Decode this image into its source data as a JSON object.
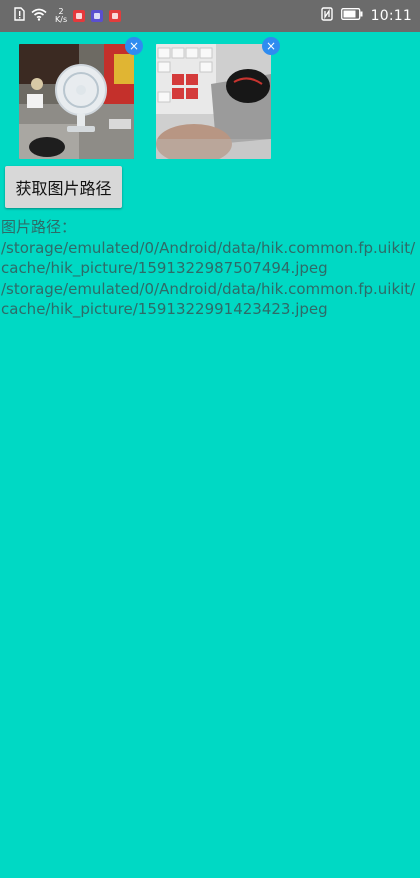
{
  "status_bar": {
    "speed_value": "2",
    "speed_unit": "K/s",
    "time": "10:11",
    "icons": [
      "sim-icon",
      "wifi-icon",
      "app-badge-red",
      "app-badge-blue",
      "app-badge-red2",
      "nfc-icon",
      "battery-icon"
    ],
    "badge_colors": [
      "#e5383b",
      "#5a4fcf",
      "#e23c3c"
    ]
  },
  "images": [
    {
      "name": "fan-desk-photo",
      "close_label": "×"
    },
    {
      "name": "keyboard-mouse-photo",
      "close_label": "×"
    }
  ],
  "button": {
    "label": "获取图片路径"
  },
  "paths": {
    "label": "图片路径：",
    "lines": [
      "/storage/emulated/0/Android/data/hik.common.fp.uikit/",
      "cache/hik_picture/1591322987507494.jpeg",
      "/storage/emulated/0/Android/data/hik.common.fp.uikit/",
      "cache/hik_picture/1591322991423423.jpeg"
    ]
  },
  "colors": {
    "background": "#00D9C4",
    "status_bar": "#6b6b6b",
    "close_button": "#2F8CF0",
    "path_text": "#2e6b68"
  }
}
